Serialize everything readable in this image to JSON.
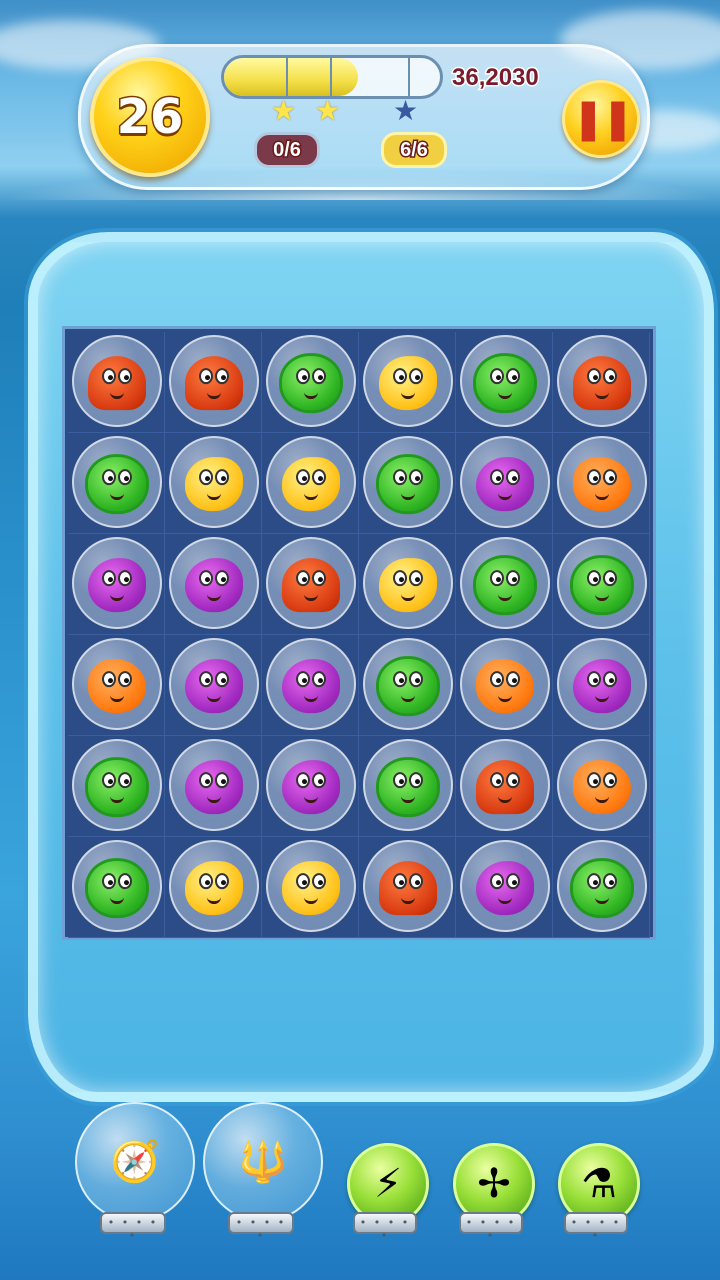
{
  "hud": {
    "moves": "26",
    "score": "36,2030",
    "progress": 0.62,
    "stars": [
      {
        "name": "star-1",
        "achieved": true
      },
      {
        "name": "star-2",
        "achieved": true
      },
      {
        "name": "star-3",
        "achieved": false
      }
    ],
    "goals": [
      {
        "value": "0/6"
      },
      {
        "value": "6/6"
      }
    ],
    "pause_icon": "pause-icon"
  },
  "board": {
    "rows": 6,
    "cols": 6,
    "tiles": [
      [
        "octopus",
        "octopus",
        "puffer",
        "goldfish",
        "puffer",
        "octopus"
      ],
      [
        "puffer",
        "goldfish",
        "goldfish",
        "puffer",
        "anglerfish",
        "clownfish"
      ],
      [
        "anglerfish",
        "anglerfish",
        "octopus",
        "goldfish",
        "puffer",
        "puffer"
      ],
      [
        "clownfish",
        "anglerfish",
        "anglerfish",
        "puffer",
        "clownfish",
        "anglerfish"
      ],
      [
        "puffer",
        "anglerfish",
        "anglerfish",
        "puffer",
        "octopus",
        "clownfish"
      ],
      [
        "puffer",
        "goldfish",
        "goldfish",
        "octopus",
        "anglerfish",
        "puffer"
      ]
    ]
  },
  "boosters": [
    {
      "name": "compass-booster",
      "icon": "compass-icon",
      "style": "globe"
    },
    {
      "name": "trident-booster",
      "icon": "trident-icon",
      "style": "globe"
    },
    {
      "name": "lightning-bomb-booster",
      "icon": "lightning-bomb-icon",
      "style": "orb"
    },
    {
      "name": "propeller-booster",
      "icon": "propeller-icon",
      "style": "orb"
    },
    {
      "name": "potion-booster",
      "icon": "potion-icon",
      "style": "orb"
    }
  ],
  "colors": {
    "board_bg": "#2b4c87",
    "ocean": "#2a90cc",
    "gold": "#ffd21a",
    "score_text": "#7a1a2a"
  }
}
